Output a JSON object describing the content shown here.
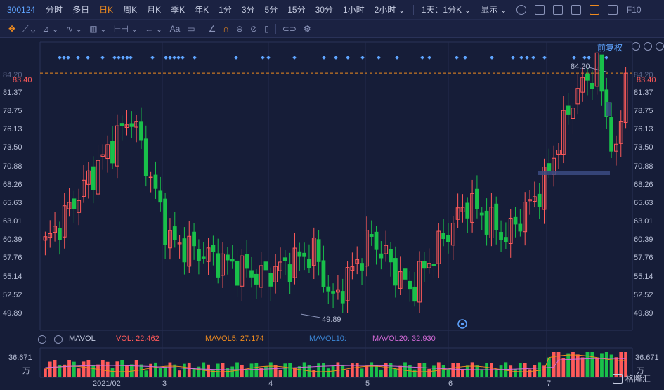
{
  "header": {
    "code": "300124",
    "tabs": [
      {
        "label": "分时",
        "active": false
      },
      {
        "label": "多日",
        "active": false
      },
      {
        "label": "日K",
        "active": true
      },
      {
        "label": "周K",
        "active": false
      },
      {
        "label": "月K",
        "active": false
      },
      {
        "label": "季K",
        "active": false
      },
      {
        "label": "年K",
        "active": false
      },
      {
        "label": "1分",
        "active": false
      },
      {
        "label": "3分",
        "active": false
      },
      {
        "label": "5分",
        "active": false
      },
      {
        "label": "15分",
        "active": false
      },
      {
        "label": "30分",
        "active": false
      },
      {
        "label": "1小时",
        "active": false
      },
      {
        "label": "2小时 ⌄",
        "active": false
      }
    ],
    "range_select": "1天：1分K ⌄",
    "display_select": "显示 ⌄",
    "f10_label": "F10"
  },
  "toolbar": {
    "text_tool": "Aa",
    "fuquan_label": "前复权"
  },
  "chart": {
    "y_labels": [
      "81.37",
      "78.75",
      "76.13",
      "73.50",
      "70.88",
      "68.26",
      "65.63",
      "63.01",
      "60.39",
      "57.76",
      "55.14",
      "52.52",
      "49.89"
    ],
    "current_price": "83.40",
    "top_partial_label": "84.20",
    "high_label": "84.20",
    "low_label": "49.89",
    "x_labels": [
      "2021/02",
      "3",
      "4",
      "5",
      "6",
      "7"
    ],
    "volume_axis_label": "36.671",
    "volume_unit": "万"
  },
  "volume_indicator": {
    "name": "MAVOL",
    "vol": "VOL: 22.462",
    "mavol5": "MAVOL5: 27.174",
    "mavol10": "MAVOL10:",
    "mavol20": "MAVOL20: 32.930"
  },
  "chart_data": {
    "type": "bar",
    "title": "",
    "x_ticks": [
      "2021/02",
      "3",
      "4",
      "5",
      "6",
      "7"
    ],
    "ylim": [
      49.89,
      84.2
    ],
    "y_ticks": [
      49.89,
      52.52,
      55.14,
      57.76,
      60.39,
      63.01,
      65.63,
      68.26,
      70.88,
      73.5,
      76.13,
      78.75,
      81.37
    ],
    "last_price": 83.4,
    "period_high": 84.2,
    "period_low": 49.89,
    "price_key_points": [
      {
        "x_index": 0,
        "close": 59.5
      },
      {
        "x_index": 18,
        "close": 77.5
      },
      {
        "x_index": 26,
        "close": 60.0
      },
      {
        "x_index": 45,
        "close": 55.0
      },
      {
        "x_index": 56,
        "close": 58.5
      },
      {
        "x_index": 60,
        "close": 51.5
      },
      {
        "x_index": 68,
        "close": 60.5
      },
      {
        "x_index": 76,
        "close": 53.0
      },
      {
        "x_index": 88,
        "close": 65.5
      },
      {
        "x_index": 96,
        "close": 60.5
      },
      {
        "x_index": 104,
        "close": 68.0
      },
      {
        "x_index": 110,
        "close": 80.0
      },
      {
        "x_index": 115,
        "close": 84.2
      },
      {
        "x_index": 119,
        "close": 71.0
      },
      {
        "x_index": 121,
        "close": 83.4
      }
    ],
    "volume_max_label": 36.671,
    "volume_unit": "万",
    "mavol": {
      "vol": 22.462,
      "mavol5": 27.174,
      "mavol20": 32.93
    }
  },
  "colors": {
    "background": "#161d38",
    "up": "#ff5a5a",
    "down": "#19c04a",
    "accent": "#f08b1e",
    "link": "#5fa4ff"
  }
}
